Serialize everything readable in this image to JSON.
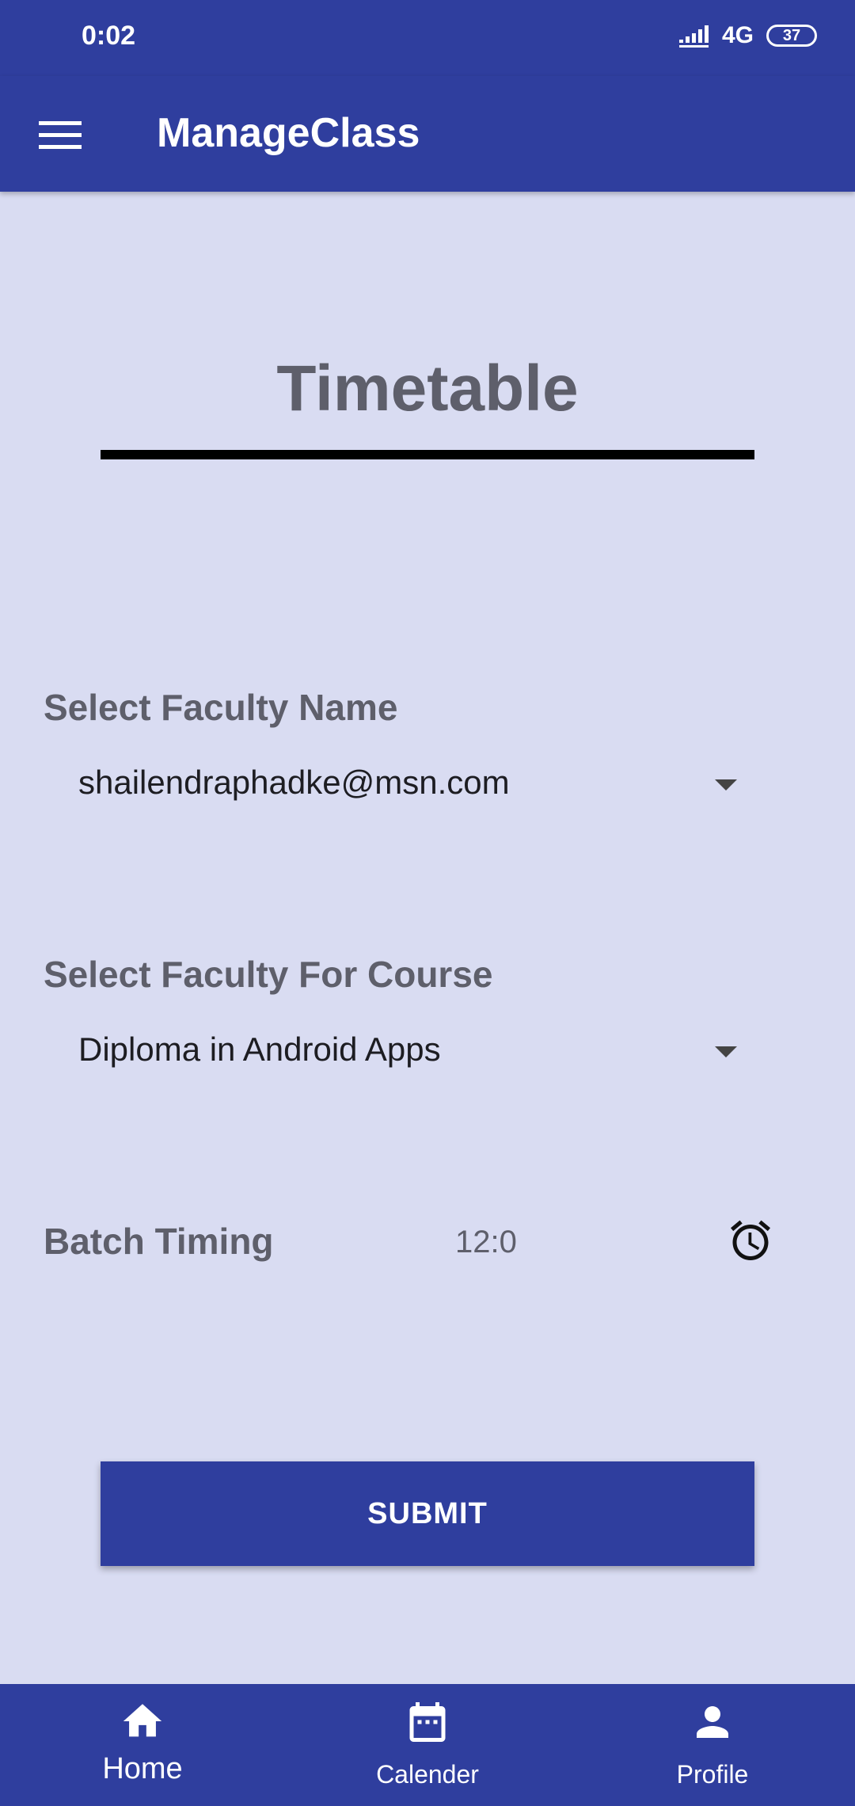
{
  "status_bar": {
    "time": "0:02",
    "network": "4G",
    "battery": "37"
  },
  "app_bar": {
    "title": "ManageClass"
  },
  "page": {
    "heading": "Timetable"
  },
  "form": {
    "faculty_name_label": "Select Faculty Name",
    "faculty_name_value": "shailendraphadke@msn.com",
    "faculty_course_label": "Select Faculty For Course",
    "faculty_course_value": "Diploma in Android Apps",
    "batch_timing_label": "Batch Timing",
    "batch_timing_value": "12:0",
    "submit_label": "SUBMIT"
  },
  "bottom_nav": {
    "items": [
      {
        "label": "Home",
        "icon": "home-icon",
        "active": true
      },
      {
        "label": "Calender",
        "icon": "calendar-icon",
        "active": false
      },
      {
        "label": "Profile",
        "icon": "person-icon",
        "active": false
      }
    ]
  },
  "colors": {
    "primary": "#2f3e9e",
    "background": "#d9dcf2",
    "label_text": "#5e5f6b"
  }
}
